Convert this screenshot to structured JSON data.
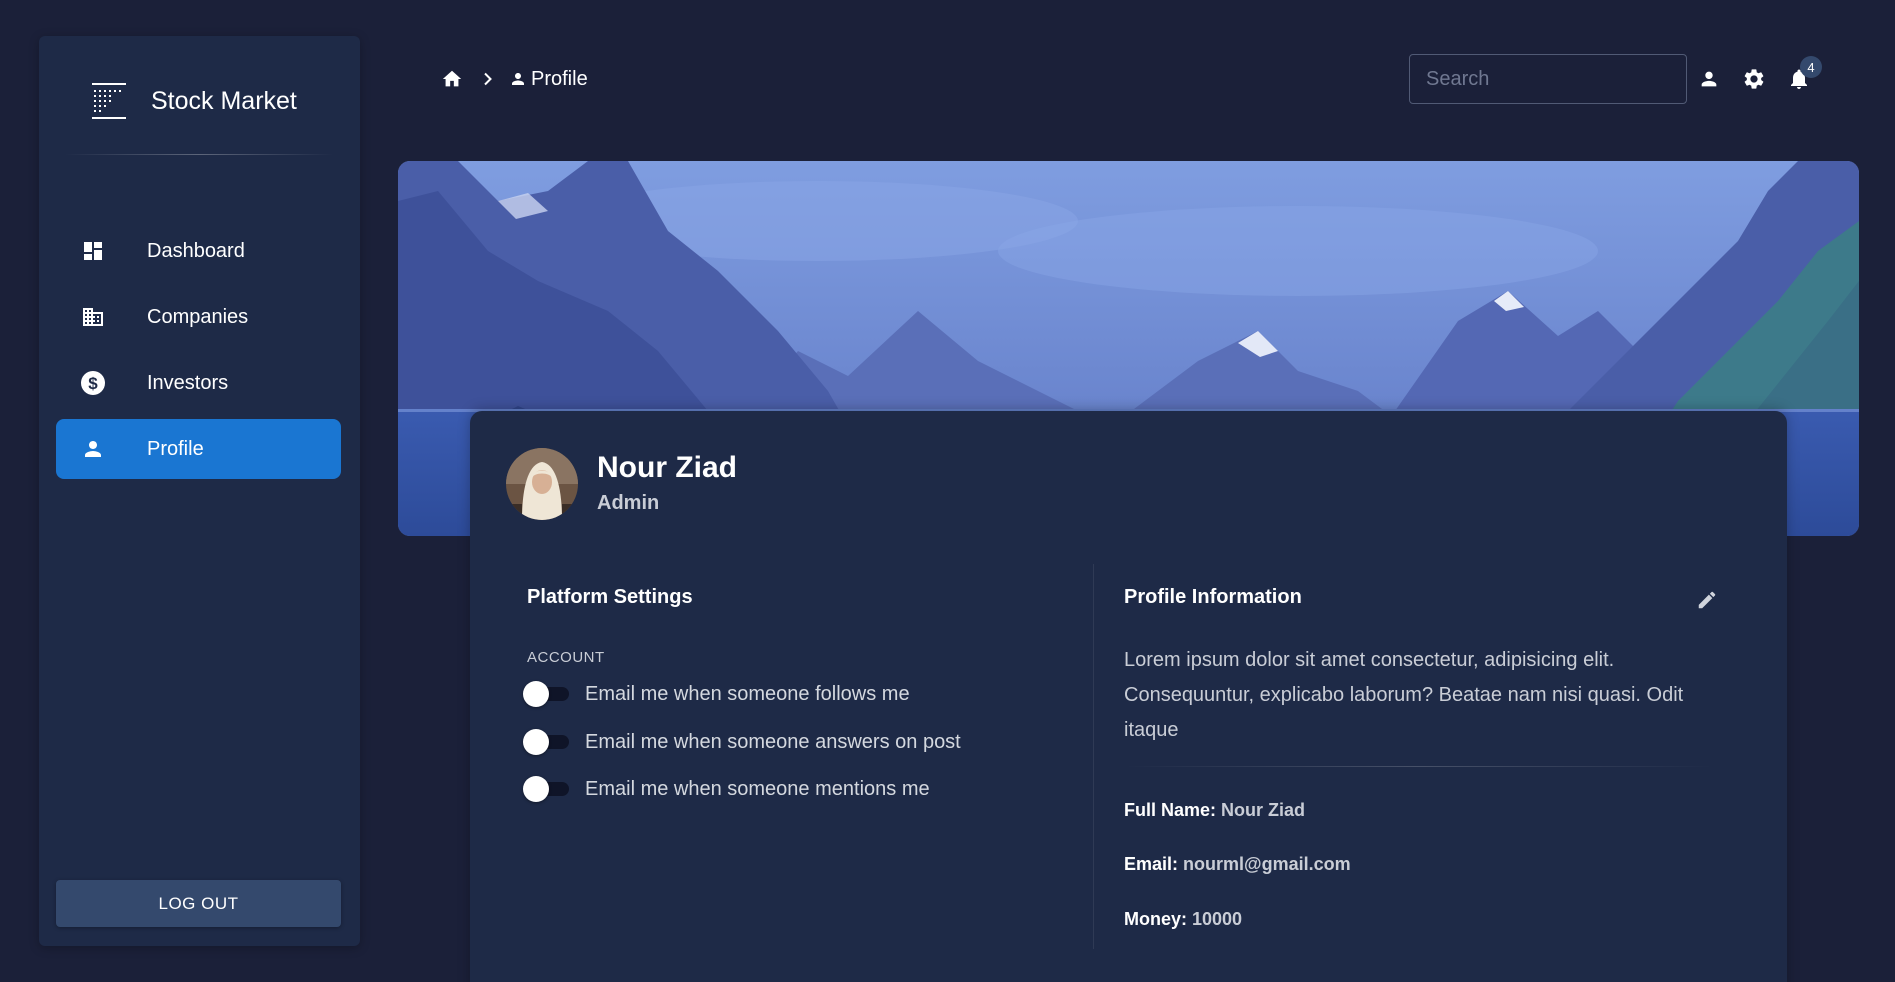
{
  "sidebar": {
    "brand_title": "Stock Market",
    "brand_icon": "grid-chart-icon",
    "items": [
      {
        "label": "Dashboard",
        "icon": "dashboard-icon",
        "active": false
      },
      {
        "label": "Companies",
        "icon": "building-icon",
        "active": false
      },
      {
        "label": "Investors",
        "icon": "dollar-icon",
        "active": false
      },
      {
        "label": "Profile",
        "icon": "person-icon",
        "active": true
      }
    ],
    "logout_label": "LOG OUT"
  },
  "header": {
    "breadcrumb": {
      "current": "Profile"
    },
    "search_placeholder": "Search",
    "notifications_count": "4"
  },
  "profile": {
    "name": "Nour Ziad",
    "role": "Admin"
  },
  "platform_settings": {
    "title": "Platform Settings",
    "account_label": "ACCOUNT",
    "toggles": [
      {
        "label": "Email me when someone follows me",
        "on": false
      },
      {
        "label": "Email me when someone answers on post",
        "on": false
      },
      {
        "label": "Email me when someone mentions me",
        "on": false
      }
    ]
  },
  "profile_information": {
    "title": "Profile Information",
    "bio": "Lorem ipsum dolor sit amet consectetur, adipisicing elit. Consequuntur, explicabo laborum? Beatae nam nisi quasi. Odit itaque",
    "full_name_label": "Full Name:",
    "full_name": "Nour Ziad",
    "email_label": "Email:",
    "email": "nourml@gmail.com",
    "money_label": "Money:",
    "money": "10000"
  },
  "colors": {
    "background": "#1b2039",
    "panel": "#1e2a47",
    "accent": "#1a76d2",
    "logout_button": "#34496d"
  }
}
